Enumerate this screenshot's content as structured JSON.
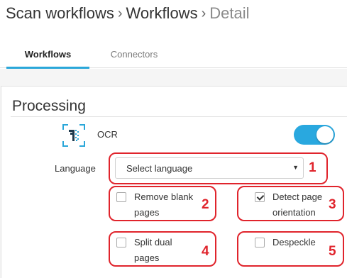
{
  "breadcrumb": {
    "items": [
      "Scan workflows",
      "Workflows",
      "Detail"
    ],
    "separator": "›"
  },
  "tabs": [
    {
      "label": "Workflows",
      "active": true
    },
    {
      "label": "Connectors",
      "active": false
    }
  ],
  "processing": {
    "title": "Processing",
    "ocr": {
      "label": "OCR",
      "enabled": true,
      "icon": "ocr-scan-icon"
    },
    "language": {
      "label": "Language",
      "selected": "Select language"
    },
    "options": [
      {
        "label": "Remove blank pages",
        "checked": false
      },
      {
        "label": "Detect page orientation",
        "checked": true
      },
      {
        "label": "Split dual pages",
        "checked": false
      },
      {
        "label": "Despeckle",
        "checked": false
      }
    ]
  },
  "annotations": [
    "1",
    "2",
    "3",
    "4",
    "5"
  ],
  "colors": {
    "accent": "#2aa7d9",
    "callout": "#e0242c"
  }
}
